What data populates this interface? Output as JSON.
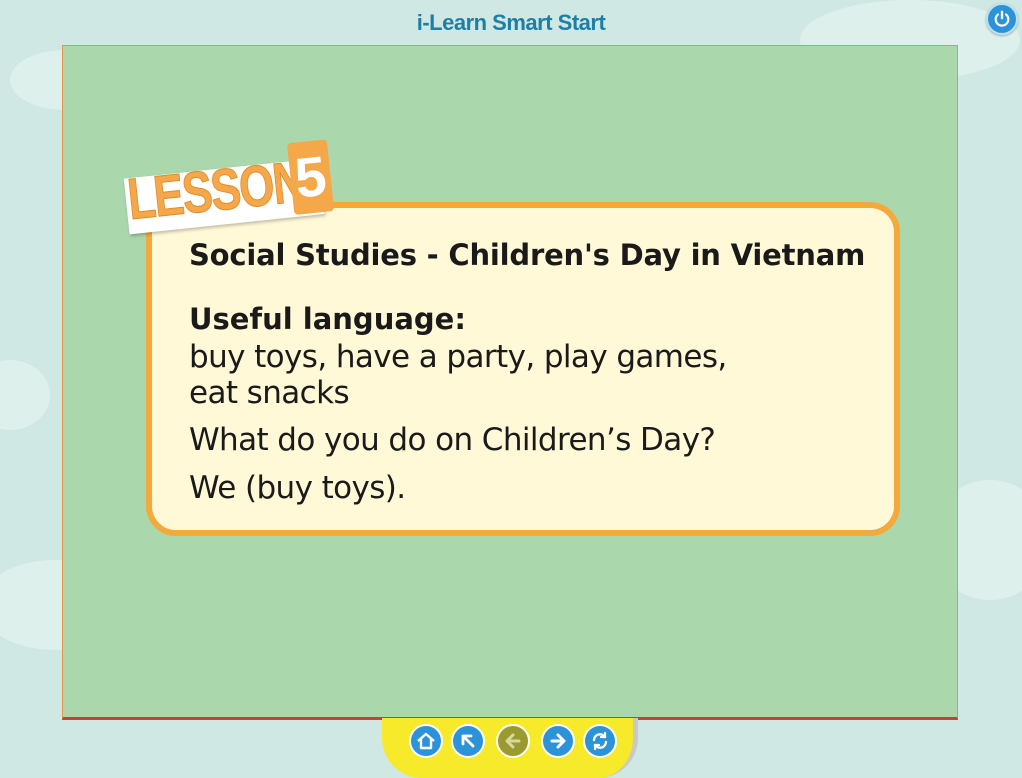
{
  "app": {
    "title": "i-Learn Smart Start"
  },
  "lesson": {
    "badge_word": "LESSON",
    "badge_number": "5",
    "heading": "Social Studies - Children's Day in Vietnam",
    "useful_label": "Useful language:",
    "lines": [
      "buy toys, have a party, play games,",
      "eat snacks",
      "What do you do on Children’s Day?",
      "We (buy toys)."
    ]
  },
  "nav": {
    "buttons": [
      {
        "icon": "home-icon",
        "enabled": true
      },
      {
        "icon": "menu-back-icon",
        "enabled": true
      },
      {
        "icon": "previous-icon",
        "enabled": false
      },
      {
        "icon": "next-icon",
        "enabled": true
      },
      {
        "icon": "replay-icon",
        "enabled": true
      }
    ]
  },
  "colors": {
    "accent_blue": "#2d93d9",
    "nav_yellow": "#f7ea2a",
    "card_border": "#f3a93b",
    "panel_green": "#abd7ad",
    "disabled_olive": "#9a9a2e"
  }
}
